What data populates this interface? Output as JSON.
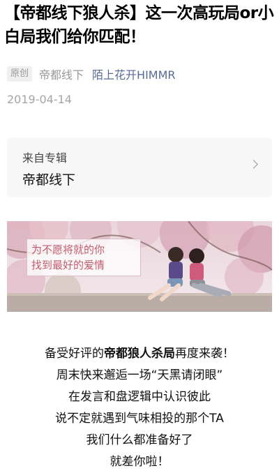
{
  "article": {
    "title": "【帝都线下狼人杀】这一次高玩局or小白局我们给你匹配！",
    "badge": "原创",
    "source": "帝都线下",
    "author": "陌上花开HIMMR",
    "date": "2019-04-14"
  },
  "album": {
    "label": "来自专辑",
    "name": "帝都线下"
  },
  "banner": {
    "line1": "为不愿将就的你",
    "line2": "找到最好的爱情"
  },
  "body": {
    "line1_pre": "备受好评的",
    "line1_bold": "帝都狼人杀局",
    "line1_post": "再度来袭！",
    "line2": "周末快来邂逅一场“天黑请闭眼”",
    "line3": "在发言和盘逻辑中认识彼此",
    "line4": "说不定就遇到气味相投的那个TA",
    "line5": "我们什么都准备好了",
    "line6": "就差你啦！"
  }
}
